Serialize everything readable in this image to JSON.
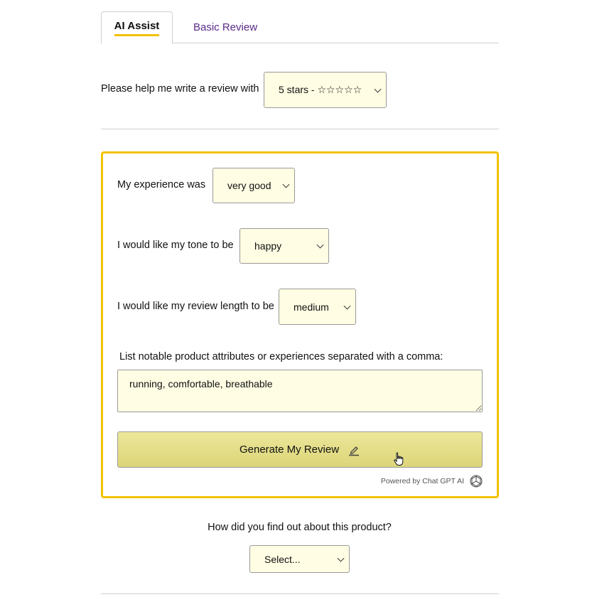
{
  "tabs": {
    "active": "AI Assist",
    "inactive": "Basic Review"
  },
  "rating": {
    "prompt": "Please help me write a review with",
    "value": "5 stars - ☆☆☆☆☆"
  },
  "assist": {
    "experience_label": "My experience was",
    "experience_value": "very good",
    "tone_label": "I would like my tone to be",
    "tone_value": "happy",
    "length_label": "I would like my review length to be",
    "length_value": "medium",
    "attributes_label": "List notable product attributes or experiences separated with a comma:",
    "attributes_value": "running, comfortable, breathable",
    "generate_label": "Generate My Review",
    "powered_by": "Powered by Chat GPT AI"
  },
  "source": {
    "question": "How did you find out about this product?",
    "value": "Select..."
  },
  "colors": {
    "accent": "#f2c200",
    "field_bg": "#fffde3",
    "button_bg": "#e4de8a",
    "tab_link": "#5a2a8a"
  }
}
